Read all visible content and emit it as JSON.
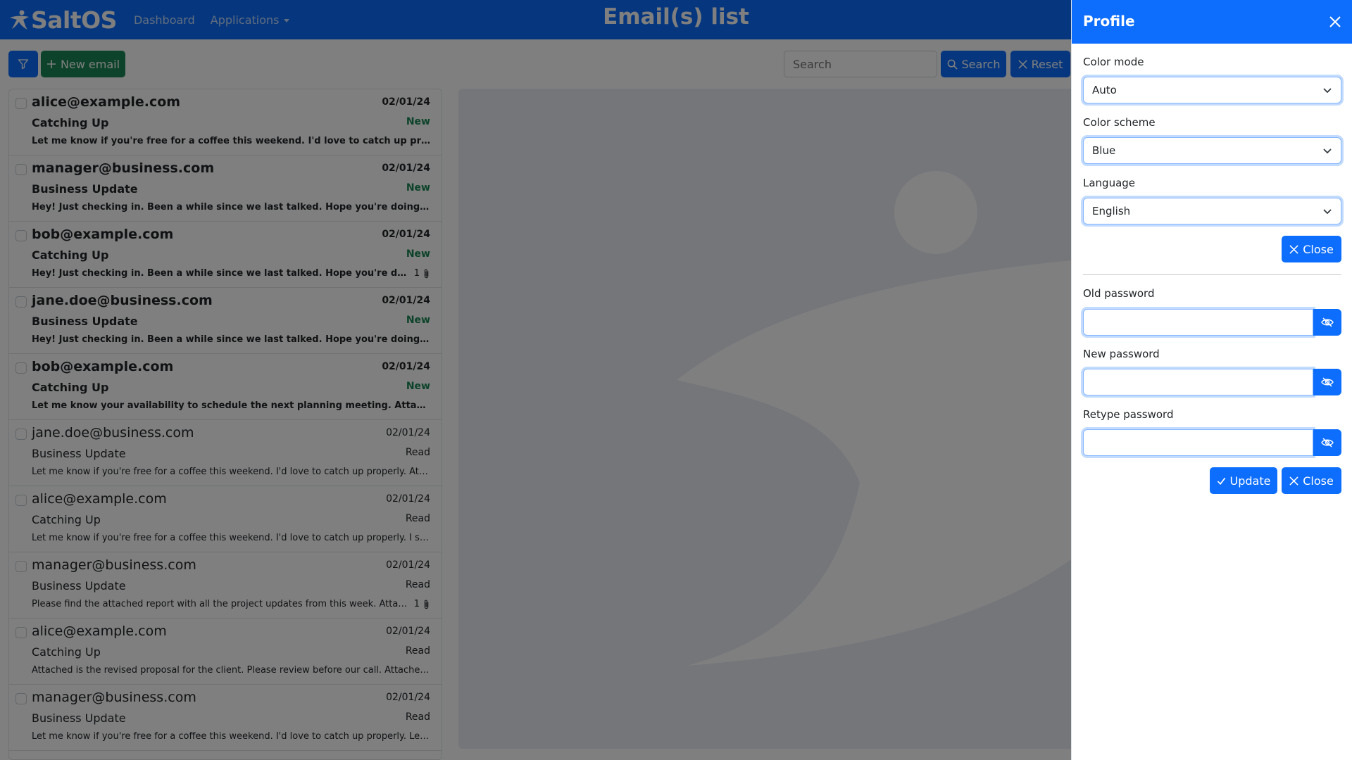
{
  "navbar": {
    "brand": "SaltOS",
    "title": "Email(s) list",
    "links": [
      "Dashboard",
      "Applications"
    ]
  },
  "toolbar": {
    "new_email": "New email",
    "search_placeholder": "Search",
    "search_label": "Search",
    "reset_label": "Reset"
  },
  "emails": [
    {
      "from": "alice@example.com",
      "date": "02/01/24",
      "subject": "Catching Up",
      "status": "New",
      "preview": "Let me know if you're free for a coffee this weekend. I'd love to catch up properly. I ...",
      "attachments": ""
    },
    {
      "from": "manager@business.com",
      "date": "02/01/24",
      "subject": "Business Update",
      "status": "New",
      "preview": "Hey! Just checking in. Been a while since we last talked. Hope you're doing well! He...",
      "attachments": ""
    },
    {
      "from": "bob@example.com",
      "date": "02/01/24",
      "subject": "Catching Up",
      "status": "New",
      "preview": "Hey! Just checking in. Been a while since we last talked. Hope you're doing wel...",
      "attachments": "1"
    },
    {
      "from": "jane.doe@business.com",
      "date": "02/01/24",
      "subject": "Business Update",
      "status": "New",
      "preview": "Hey! Just checking in. Been a while since we last talked. Hope you're doing well! I s...",
      "attachments": ""
    },
    {
      "from": "bob@example.com",
      "date": "02/01/24",
      "subject": "Catching Up",
      "status": "New",
      "preview": "Let me know your availability to schedule the next planning meeting. Attached is th...",
      "attachments": ""
    },
    {
      "from": "jane.doe@business.com",
      "date": "02/01/24",
      "subject": "Business Update",
      "status": "Read",
      "preview": "Let me know if you're free for a coffee this weekend. I'd love to catch up properly. Attached...",
      "attachments": ""
    },
    {
      "from": "alice@example.com",
      "date": "02/01/24",
      "subject": "Catching Up",
      "status": "Read",
      "preview": "Let me know if you're free for a coffee this weekend. I'd love to catch up properly. I saw yo...",
      "attachments": ""
    },
    {
      "from": "manager@business.com",
      "date": "02/01/24",
      "subject": "Business Update",
      "status": "Read",
      "preview": "Please find the attached report with all the project updates from this week. Attached i...",
      "attachments": "1"
    },
    {
      "from": "alice@example.com",
      "date": "02/01/24",
      "subject": "Catching Up",
      "status": "Read",
      "preview": "Attached is the revised proposal for the client. Please review before our call. Attached is th...",
      "attachments": ""
    },
    {
      "from": "manager@business.com",
      "date": "02/01/24",
      "subject": "Business Update",
      "status": "Read",
      "preview": "Let me know if you're free for a coffee this weekend. I'd love to catch up properly. Let me k...",
      "attachments": ""
    }
  ],
  "profile": {
    "title": "Profile",
    "color_mode_label": "Color mode",
    "color_mode_value": "Auto",
    "color_scheme_label": "Color scheme",
    "color_scheme_value": "Blue",
    "language_label": "Language",
    "language_value": "English",
    "close_label": "Close",
    "old_password_label": "Old password",
    "new_password_label": "New password",
    "retype_password_label": "Retype password",
    "update_label": "Update"
  },
  "colors": {
    "primary": "#0d6efd",
    "success": "#198754"
  }
}
